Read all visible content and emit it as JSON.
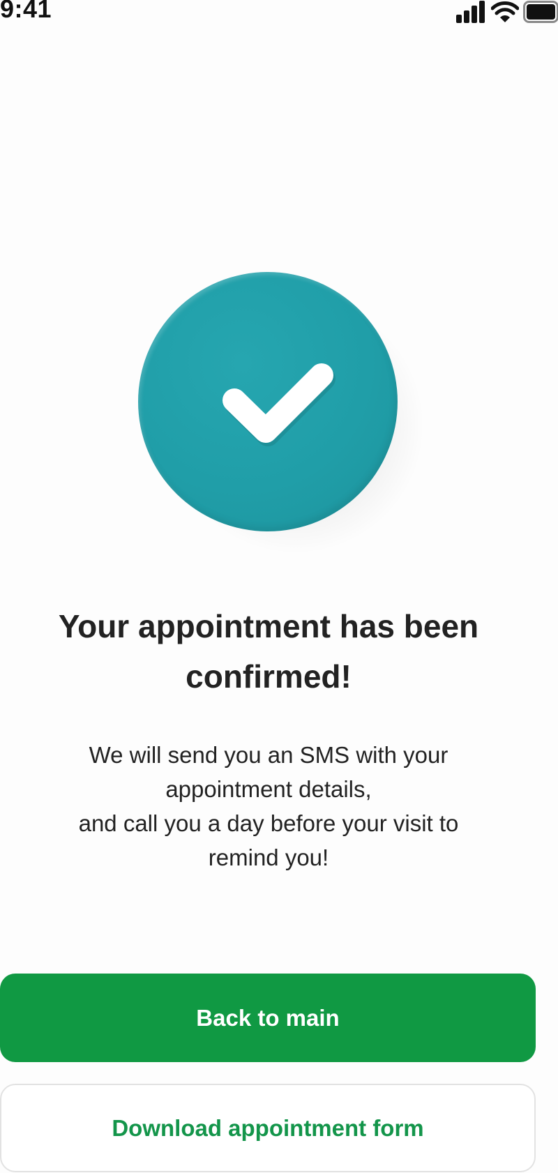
{
  "status_bar": {
    "time": "9:41",
    "icons": [
      "signal-icon",
      "wifi-icon",
      "battery-icon"
    ]
  },
  "confirmation": {
    "icon": "checkmark-icon",
    "badge_color": "#209ea8",
    "title": "Your appointment has been confirmed!",
    "message": "We will send you an SMS with your appointment details,\nand call you a day before your visit to remind you!"
  },
  "actions": {
    "primary_label": "Back to main",
    "primary_color": "#109943",
    "secondary_label": "Download appointment form",
    "secondary_text_color": "#13954a"
  }
}
